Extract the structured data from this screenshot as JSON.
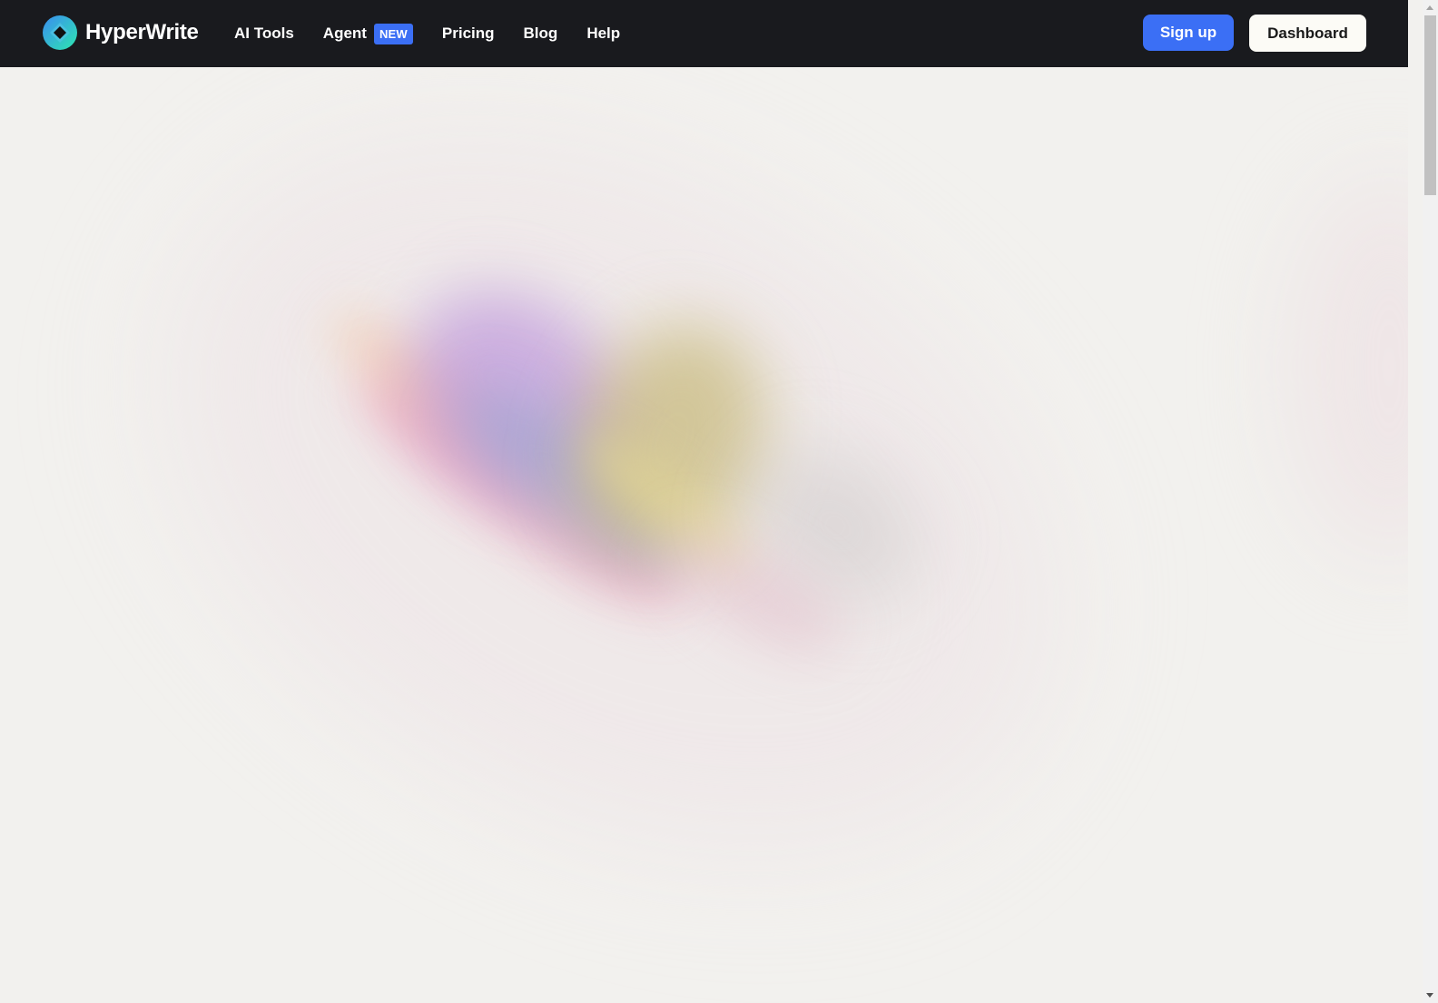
{
  "brand": {
    "name": "HyperWrite",
    "logo_icon": "hyperwrite-logo-icon"
  },
  "nav": {
    "links": [
      {
        "label": "AI Tools"
      },
      {
        "label": "Agent",
        "badge": "NEW"
      },
      {
        "label": "Pricing"
      },
      {
        "label": "Blog"
      },
      {
        "label": "Help"
      }
    ]
  },
  "actions": {
    "signup_label": "Sign up",
    "dashboard_label": "Dashboard"
  },
  "colors": {
    "navbar_bg": "#191a1e",
    "accent": "#3b6ff5",
    "page_bg": "#f2f1ee"
  }
}
